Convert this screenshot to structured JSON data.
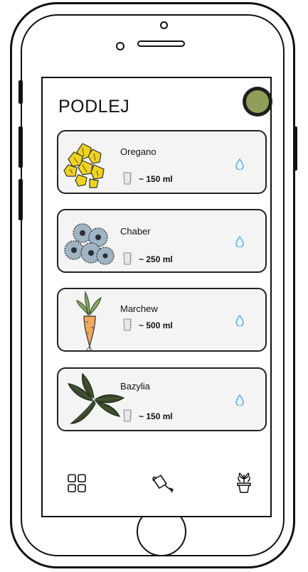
{
  "screen": {
    "title": "PODLEJ"
  },
  "plants": [
    {
      "name": "Oregano",
      "amount": "~ 150 ml",
      "icon": "oregano-icon"
    },
    {
      "name": "Chaber",
      "amount": "~ 250 ml",
      "icon": "chaber-icon"
    },
    {
      "name": "Marchew",
      "amount": "~ 500 ml",
      "icon": "marchew-icon"
    },
    {
      "name": "Bazylia",
      "amount": "~ 150 ml",
      "icon": "bazylia-icon"
    }
  ],
  "nav": {
    "items": [
      "grid-icon",
      "watering-can-icon",
      "potted-plant-icon"
    ]
  },
  "colors": {
    "accent": "#4aa3df",
    "avatar": "#8f9f5a",
    "card_bg": "#f4f4f4"
  }
}
